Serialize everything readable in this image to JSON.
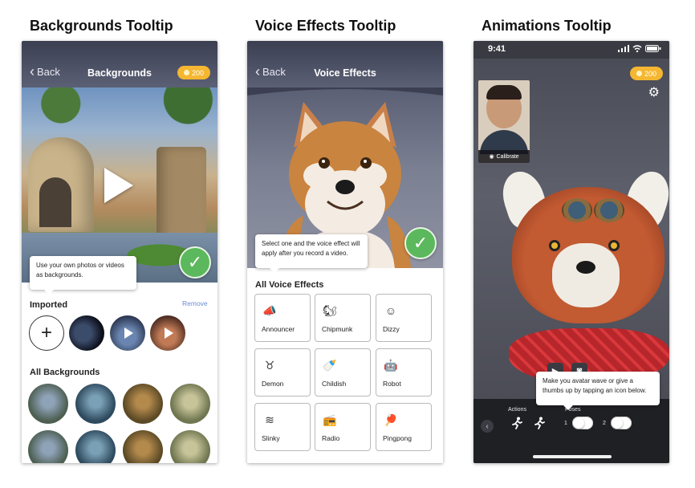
{
  "titles": {
    "col1": "Backgrounds Tooltip",
    "col2": "Voice Effects Tooltip",
    "col3": "Animations Tooltip"
  },
  "colors": {
    "nav_gradient_top": "#3c3f52",
    "coin_badge": "#f5b731",
    "confirm_green": "#5cb85c",
    "remove_link": "#6b8bd6"
  },
  "backgrounds": {
    "back_label": "Back",
    "nav_title": "Backgrounds",
    "coins": "200",
    "tooltip": "Use your own photos or videos as backgrounds.",
    "imported_heading": "Imported",
    "remove_label": "Remove",
    "add_symbol": "+",
    "all_heading": "All Backgrounds",
    "confirm_icon": "✓"
  },
  "voice": {
    "back_label": "Back",
    "nav_title": "Voice Effects",
    "tooltip": "Select one and the voice effect will apply after you record a video.",
    "heading": "All Voice Effects",
    "confirm_icon": "✓",
    "effects": [
      {
        "label": "Announcer",
        "icon": "📣"
      },
      {
        "label": "Chipmunk",
        "icon": "🐿"
      },
      {
        "label": "Dizzy",
        "icon": "☺"
      },
      {
        "label": "Demon",
        "icon": "♉"
      },
      {
        "label": "Childish",
        "icon": "🍼"
      },
      {
        "label": "Robot",
        "icon": "🤖"
      },
      {
        "label": "Slinky",
        "icon": "≋"
      },
      {
        "label": "Radio",
        "icon": "📻"
      },
      {
        "label": "Pingpong",
        "icon": "🏓"
      }
    ]
  },
  "animations": {
    "time": "9:41",
    "coins": "200",
    "calibrate": "Calibrate",
    "tooltip": "Make you avatar wave or give a thumbs up by tapping an icon below.",
    "actions_label": "Actions",
    "poses_label": "Poses",
    "pose_1": "1",
    "pose_2": "2"
  }
}
